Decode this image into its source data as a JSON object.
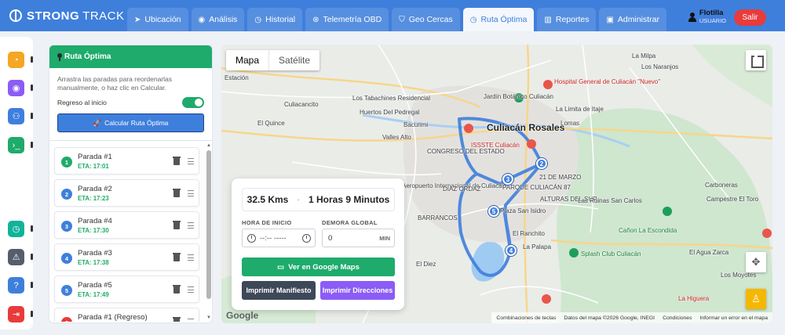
{
  "brand": {
    "strong": "STRONG",
    "track": "TRACK"
  },
  "nav": {
    "tabs": [
      {
        "label": "Ubicación",
        "icon": "➤"
      },
      {
        "label": "Análisis",
        "icon": "◉"
      },
      {
        "label": "Historial",
        "icon": "◷"
      },
      {
        "label": "Telemetría OBD",
        "icon": "⊛"
      },
      {
        "label": "Geo Cercas",
        "icon": "⛉"
      },
      {
        "label": "Ruta Óptima",
        "icon": "◷"
      },
      {
        "label": "Reportes",
        "icon": "▥"
      },
      {
        "label": "Administrar",
        "icon": "▣"
      }
    ]
  },
  "user": {
    "name": "Flotilla",
    "role": "USUARIO",
    "logout": "Salir"
  },
  "panel": {
    "title": "Ruta Óptima",
    "description": "Arrastra las paradas para reordenarlas manualmente, o haz clic en Calcular.",
    "return_label": "Regreso al inicio",
    "calc_button": "Calcular Ruta Óptima",
    "stops": [
      {
        "num": "1",
        "name": "Parada #1",
        "eta": "ETA: 17:01",
        "color": "#1eab6b"
      },
      {
        "num": "2",
        "name": "Parada #2",
        "eta": "ETA: 17:23",
        "color": "#3f7fdc"
      },
      {
        "num": "3",
        "name": "Parada #4",
        "eta": "ETA: 17:30",
        "color": "#3f7fdc"
      },
      {
        "num": "4",
        "name": "Parada #3",
        "eta": "ETA: 17:38",
        "color": "#3f7fdc"
      },
      {
        "num": "5",
        "name": "Parada #5",
        "eta": "ETA: 17:49",
        "color": "#3f7fdc"
      },
      {
        "num": "6",
        "name": "Parada #1 (Regreso)",
        "eta": "",
        "color": "#e83b3b"
      }
    ]
  },
  "map": {
    "type_map": "Mapa",
    "type_sat": "Satélite",
    "google": "Google",
    "attribution": [
      "Combinaciones de teclas",
      "Datos del mapa ©2026 Google, INEGI",
      "Condiciones",
      "Informar un error en el mapa"
    ],
    "labels": {
      "milpa": "La Milpa",
      "naranjos": "Los Naranjos",
      "hospital": "Hospital General de Culiacán \"Nuevo\"",
      "limita": "La Limita de Itaje",
      "lomas": "Lomas",
      "culiacancito": "Culiacancito",
      "tabachines": "Los Tabachines Residencial",
      "huertos": "Huertos Del Pedregal",
      "jardin": "Jardín Botánico Culiacán",
      "bacurimi": "Bacurimi",
      "quince": "El Quince",
      "culiacan": "Culiacán Rosales",
      "issste": "ISSSTE Culiacán",
      "valles": "Valles Alto",
      "congreso": "CONGRESO DEL ESTADO",
      "aeropuerto": "Aeropuerto Internacional de Culiacán",
      "diazordaz": "DÍAZ ORDAZ",
      "parque87": "PARQUE CULIACÁN 87",
      "marzo": "21 DE MARZO",
      "alturas": "ALTURAS DEL SUR",
      "barrancos": "BARRANCOS",
      "sanisidro": "Plaza San Isidro",
      "carboneras": "Carboneras",
      "campestre": "Campestre El Toro",
      "sancarlos": "Las Ruinas San Carlos",
      "escondida": "Cañon La Escondida",
      "ranchito": "El Ranchito",
      "palapa": "La Palapa",
      "splash": "Splash Club Culiacán",
      "aguazarca": "El Agua Zarca",
      "diez": "El Diez",
      "higuera": "La Higuera",
      "moyotes": "Los Moyotes",
      "estacion": "Estación"
    },
    "markers": [
      "2",
      "3",
      "4",
      "5"
    ]
  },
  "summary": {
    "distance": "32.5 Kms",
    "separator": "-",
    "duration": "1 Horas 9 Minutos",
    "start_label": "HORA DE INICIO",
    "start_value": "--:-- -----",
    "delay_label": "DEMORA GLOBAL",
    "delay_value": "0",
    "delay_unit": "MIN",
    "gmaps_button": "Ver en Google Maps",
    "manifest_button": "Imprimir Manifiesto",
    "directions_button": "Imprimir Direcciones"
  },
  "colors": {
    "nav": "#3f7fdc",
    "green": "#1eab6b",
    "red": "#e83b3b",
    "purple": "#8b5cf6",
    "dark": "#3d4858"
  }
}
